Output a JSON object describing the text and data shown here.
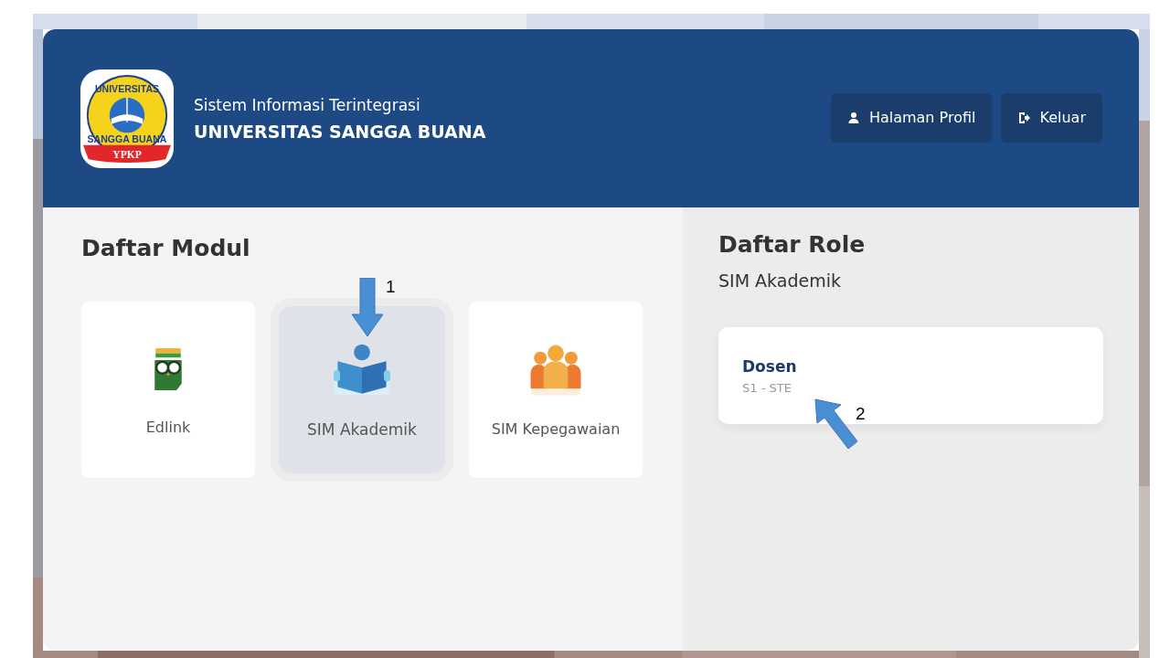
{
  "header": {
    "logo": {
      "top": "UNIVERSITAS",
      "bottom": "SANGGA BUANA",
      "banner": "YPKP"
    },
    "subtitle": "Sistem Informasi Terintegrasi",
    "title": "UNIVERSITAS SANGGA BUANA",
    "buttons": [
      {
        "label": "Halaman Profil",
        "kind": "profile"
      },
      {
        "label": "Keluar",
        "kind": "logout"
      }
    ]
  },
  "modules": {
    "heading": "Daftar Modul",
    "items": [
      {
        "label": "Edlink",
        "kind": "edlink",
        "selected": false
      },
      {
        "label": "SIM Akademik",
        "kind": "academic",
        "selected": true
      },
      {
        "label": "SIM Kepegawaian",
        "kind": "staff",
        "selected": false
      }
    ]
  },
  "roles": {
    "heading": "Daftar Role",
    "module": "SIM Akademik",
    "items": [
      {
        "name": "Dosen",
        "unit": "S1 - STE"
      }
    ]
  },
  "annotations": [
    {
      "label": "1",
      "kind": "down"
    },
    {
      "label": "2",
      "kind": "diagonal"
    }
  ]
}
